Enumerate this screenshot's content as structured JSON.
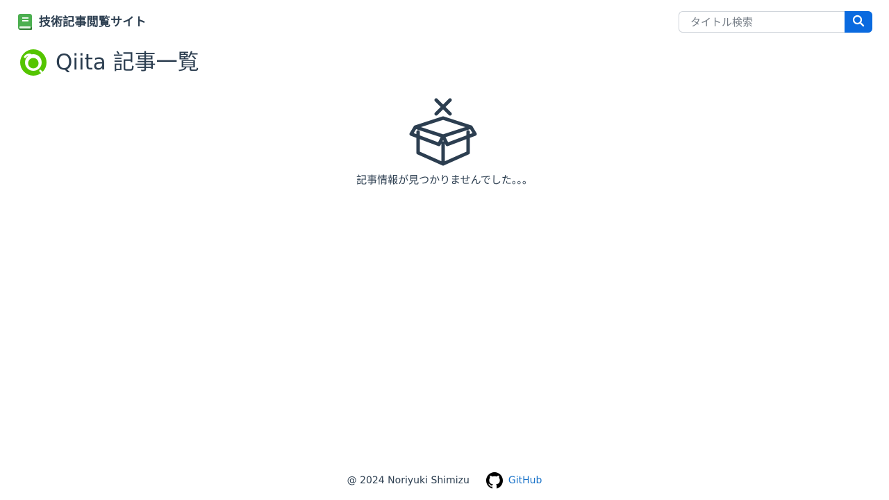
{
  "header": {
    "site_title": "技術記事閲覧サイト",
    "brand_icon": "book-icon",
    "search": {
      "placeholder": "タイトル検索",
      "value": "",
      "button_icon": "search-icon"
    }
  },
  "main": {
    "page_title": "Qiita 記事一覧",
    "logo_icon": "qiita-logo-icon",
    "empty_state": {
      "icon": "empty-box-icon",
      "message": "記事情報が見つかりませんでした。。。"
    }
  },
  "footer": {
    "copyright": "@ 2024 Noriyuki Shimizu",
    "github_label": "GitHub",
    "github_icon": "github-icon"
  },
  "colors": {
    "text": "#2c3e50",
    "accent": "#0a6adf",
    "brand_green": "#4caf50",
    "qiita_green": "#55c500",
    "link": "#1a73c9"
  }
}
